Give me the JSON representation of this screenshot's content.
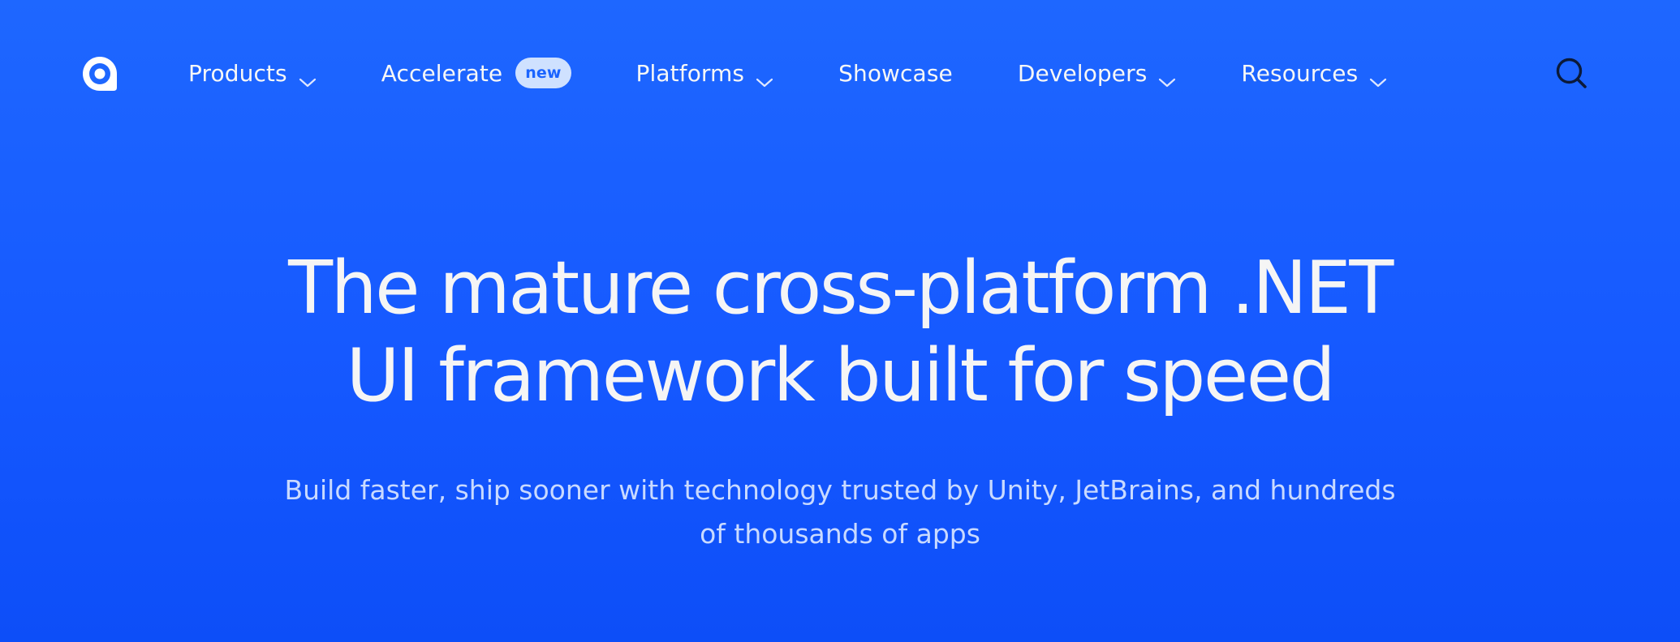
{
  "colors": {
    "background_top": "#1e67ff",
    "background_bottom": "#0d4ef8",
    "nav_text": "#f7f7f7",
    "badge_bg": "#cfe1ff",
    "badge_text": "#1a64ff",
    "subtitle_text": "#c9daff",
    "search_icon": "#0b1a3a"
  },
  "logo": {
    "icon": "avalonia-logo-icon"
  },
  "nav": {
    "items": [
      {
        "label": "Products",
        "has_dropdown": true
      },
      {
        "label": "Accelerate",
        "badge": "new",
        "has_dropdown": false
      },
      {
        "label": "Platforms",
        "has_dropdown": true
      },
      {
        "label": "Showcase",
        "has_dropdown": false
      },
      {
        "label": "Developers",
        "has_dropdown": true
      },
      {
        "label": "Resources",
        "has_dropdown": true
      }
    ],
    "search_icon": "search-icon"
  },
  "hero": {
    "title_line1": "The mature cross-platform .NET",
    "title_line2": "UI framework built for speed",
    "subtitle_line1": "Build faster, ship sooner with technology trusted by Unity, JetBrains, and hundreds",
    "subtitle_line2": "of thousands of apps"
  }
}
